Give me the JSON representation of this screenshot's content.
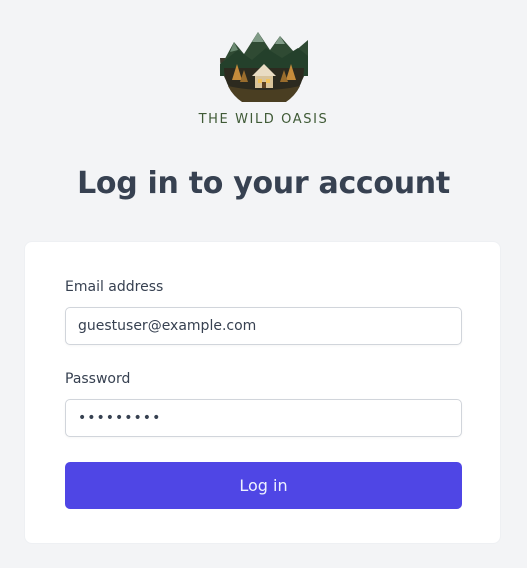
{
  "brand": {
    "name": "THE WILD OASIS",
    "logo_icon": "mountain-cabin-logo"
  },
  "page": {
    "title": "Log in to your account"
  },
  "form": {
    "email_label": "Email address",
    "email_value": "guestuser@example.com",
    "password_label": "Password",
    "password_value": "guestpass",
    "submit_label": "Log in"
  },
  "colors": {
    "background": "#f3f4f6",
    "card": "#ffffff",
    "accent": "#4f46e5",
    "brand_green": "#3f5a36"
  }
}
